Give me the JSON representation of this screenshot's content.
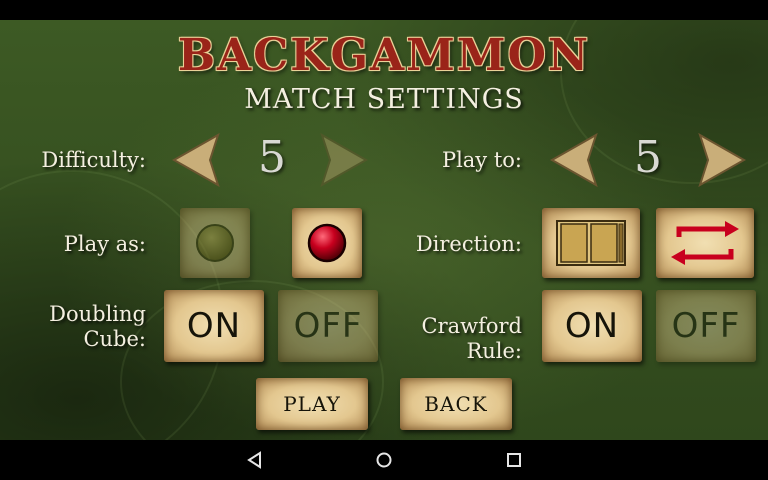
{
  "title": "BACKGAMMON",
  "subtitle": "MATCH SETTINGS",
  "difficulty": {
    "label": "Difficulty:",
    "value": "5"
  },
  "play_to": {
    "label": "Play to:",
    "value": "5"
  },
  "play_as": {
    "label": "Play as:",
    "options": [
      "yellow checker",
      "red checker"
    ],
    "selected": "red checker"
  },
  "direction": {
    "label": "Direction:",
    "options": [
      "board layout",
      "swap direction"
    ]
  },
  "doubling_cube": {
    "label_line1": "Doubling",
    "label_line2": "Cube:",
    "on": "ON",
    "off": "OFF",
    "selected": "ON"
  },
  "crawford_rule": {
    "label": "Crawford Rule:",
    "on": "ON",
    "off": "OFF",
    "selected": "ON"
  },
  "buttons": {
    "play": "PLAY",
    "back": "BACK"
  },
  "colors": {
    "title": "#9a2419",
    "tile": "#e3c78f",
    "background": "#365020",
    "red_checker": "#b3001b"
  }
}
